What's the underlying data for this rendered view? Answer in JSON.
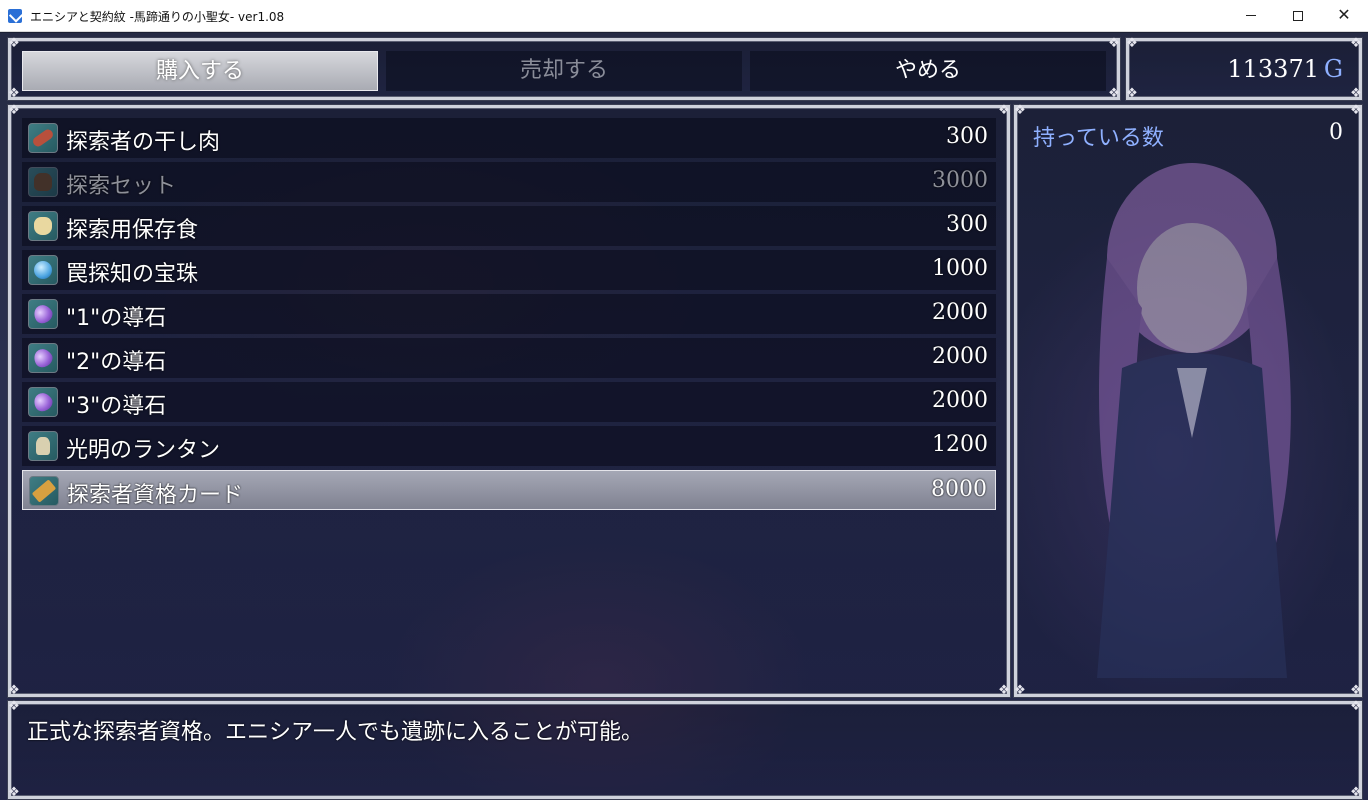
{
  "window": {
    "title": "エニシアと契約紋 -馬蹄通りの小聖女- ver1.08",
    "minimize_glyph": "",
    "maximize_glyph": "",
    "close_glyph": "✕"
  },
  "commands": {
    "buy": "購入する",
    "sell": "売却する",
    "cancel": "やめる",
    "selected": "buy"
  },
  "gold": {
    "value": "113371",
    "unit": "G"
  },
  "items": [
    {
      "name": "探索者の干し肉",
      "price": "300",
      "icon": "dried-meat-icon",
      "enabled": true
    },
    {
      "name": "探索セット",
      "price": "3000",
      "icon": "explorer-set-icon",
      "enabled": false
    },
    {
      "name": "探索用保存食",
      "price": "300",
      "icon": "ration-bag-icon",
      "enabled": true
    },
    {
      "name": "罠探知の宝珠",
      "price": "1000",
      "icon": "crystal-orb-icon",
      "enabled": true
    },
    {
      "name": "\"1\"の導石",
      "price": "2000",
      "icon": "purple-stone-icon",
      "enabled": true
    },
    {
      "name": "\"2\"の導石",
      "price": "2000",
      "icon": "purple-stone-icon",
      "enabled": true
    },
    {
      "name": "\"3\"の導石",
      "price": "2000",
      "icon": "purple-stone-icon",
      "enabled": true
    },
    {
      "name": "光明のランタン",
      "price": "1200",
      "icon": "lantern-icon",
      "enabled": true
    },
    {
      "name": "探索者資格カード",
      "price": "8000",
      "icon": "license-card-icon",
      "enabled": true,
      "selected": true
    }
  ],
  "status": {
    "possession_label": "持っている数",
    "possession_value": "0"
  },
  "help": {
    "text": "正式な探索者資格。エニシア一人でも遺跡に入ることが可能。"
  },
  "colors": {
    "system_blue": "#8fb0ff",
    "window_border": "#cfd2dc",
    "disabled_text": "#8e9099"
  }
}
